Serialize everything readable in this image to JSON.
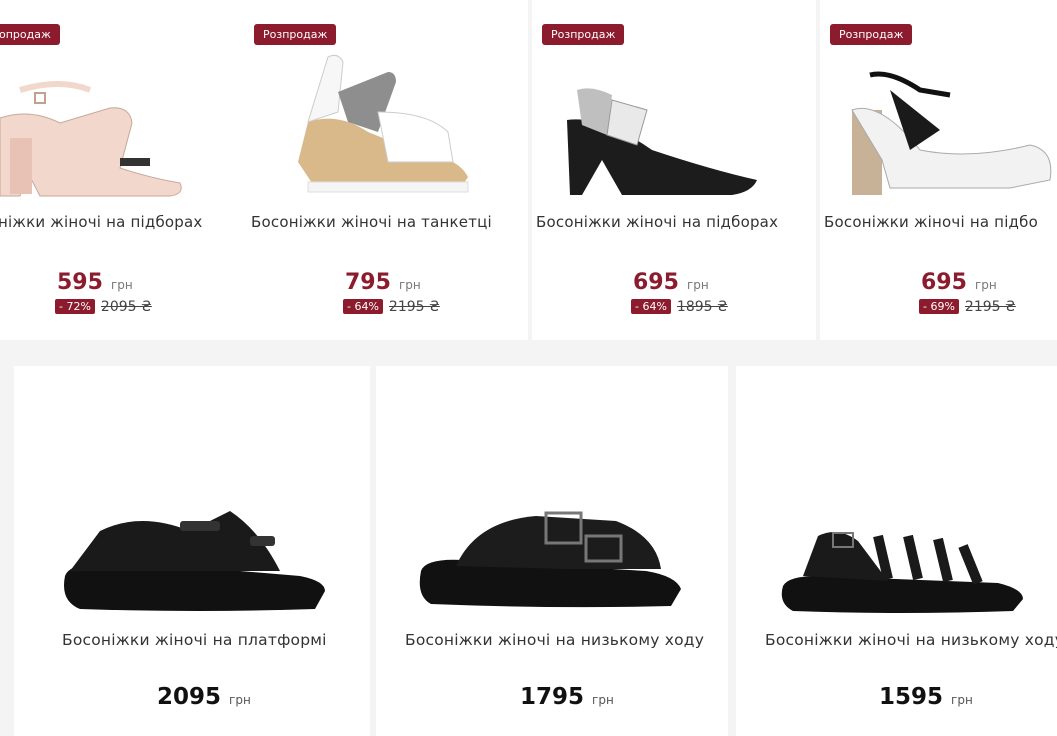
{
  "top_products": [
    {
      "badge": "Розпродаж",
      "badge_visible": "опродаж",
      "title": "Босоніжки жіночі на підборах",
      "title_visible": "ніжки жіночі на підборах",
      "price": "595",
      "currency": "грн",
      "discount": "- 72%",
      "old_price": "2095 ₴"
    },
    {
      "badge": "Розпродаж",
      "title": "Босоніжки жіночі на танкетці",
      "price": "795",
      "currency": "грн",
      "discount": "- 64%",
      "old_price": "2195 ₴"
    },
    {
      "badge": "Розпродаж",
      "title": "Босоніжки жіночі на підборах",
      "price": "695",
      "currency": "грн",
      "discount": "- 64%",
      "old_price": "1895 ₴"
    },
    {
      "badge": "Розпродаж",
      "title": "Босоніжки жіночі на підбо",
      "price": "695",
      "currency": "грн",
      "discount": "- 69%",
      "old_price": "2195 ₴"
    }
  ],
  "bottom_products": [
    {
      "title": "Босоніжки жіночі на платформі",
      "price": "2095",
      "currency": "грн"
    },
    {
      "title": "Босоніжки жіночі на низькому ходу",
      "price": "1795",
      "currency": "грн"
    },
    {
      "title": "Босоніжки жіночі на низькому ходу",
      "price": "1595",
      "currency": "грн"
    }
  ],
  "colors": {
    "accent": "#8d1b2e",
    "background": "#f4f4f4",
    "card": "#ffffff"
  }
}
